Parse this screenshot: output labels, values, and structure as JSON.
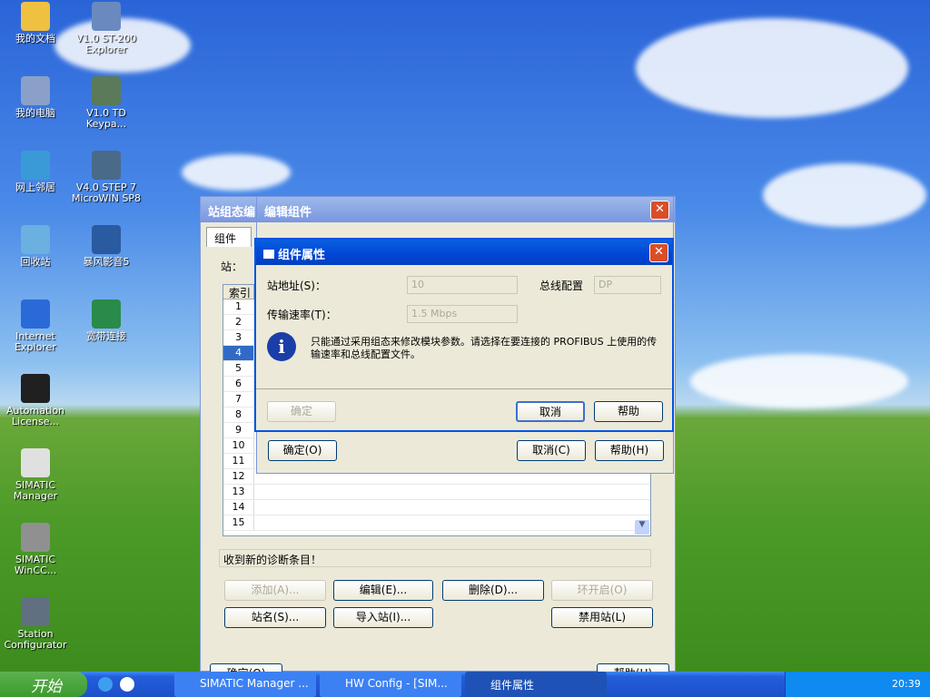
{
  "desktop": {
    "icons": [
      {
        "label": "我的文档"
      },
      {
        "label": "V1.0 ST-200 Explorer"
      },
      {
        "label": "我的电脑"
      },
      {
        "label": "V1.0 TD Keypa..."
      },
      {
        "label": "网上邻居"
      },
      {
        "label": "V4.0 STEP 7 MicroWIN SP8"
      },
      {
        "label": "回收站"
      },
      {
        "label": "暴风影音5"
      },
      {
        "label": "Internet Explorer"
      },
      {
        "label": "宽带连接"
      },
      {
        "label": "Automation License..."
      },
      {
        "label": "SIMATIC Manager"
      },
      {
        "label": "SIMATIC WinCC..."
      },
      {
        "label": "Station Configurator"
      }
    ]
  },
  "station_editor": {
    "title": "站组态编",
    "tab": "组件",
    "station_label": "站：",
    "col_index": "索引",
    "rows": [
      "1",
      "2",
      "3",
      "4",
      "5",
      "6",
      "7",
      "8",
      "9",
      "10",
      "11",
      "12",
      "13",
      "14",
      "15"
    ],
    "selected_row": "4",
    "status": "收到新的诊断条目！",
    "buttons": {
      "add": "添加(A)...",
      "edit": "编辑(E)...",
      "delete": "删除(D)...",
      "ring_on": "环开启(O)",
      "station_name": "站名(S)...",
      "import_station": "导入站(I)...",
      "disable_station": "禁用站(L)",
      "ok": "确定(O)",
      "help": "帮助(H)"
    }
  },
  "edit_component": {
    "title": "编辑组件",
    "ok": "确定(O)",
    "cancel": "取消(C)",
    "help": "帮助(H)"
  },
  "props": {
    "title": "组件属性",
    "addr_label": "站地址(S)：",
    "addr_value": "10",
    "bus_label": "总线配置",
    "bus_value": "DP",
    "rate_label": "传输速率(T)：",
    "rate_value": "1.5 Mbps",
    "info": "只能通过采用组态来修改模块参数。请选择在要连接的 PROFIBUS 上使用的传输速率和总线配置文件。",
    "ok": "确定",
    "cancel": "取消",
    "help": "帮助"
  },
  "taskbar": {
    "start": "开始",
    "tasks": [
      "SIMATIC Manager ...",
      "HW Config - [SIM...",
      "组件属性"
    ],
    "time": "20:39"
  }
}
